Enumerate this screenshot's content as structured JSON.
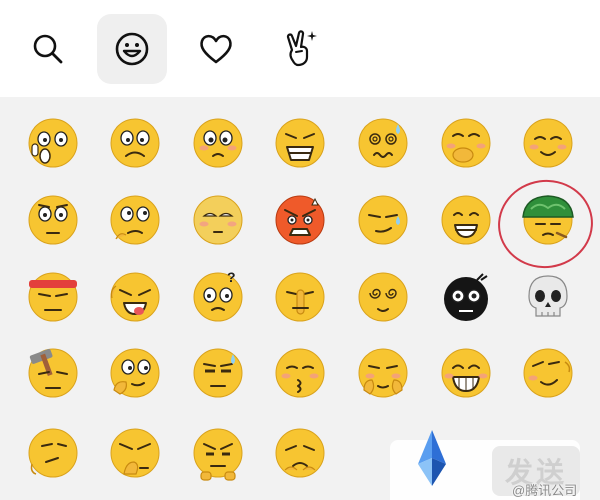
{
  "tabs": [
    {
      "name": "search",
      "icon": "search-icon",
      "active": false
    },
    {
      "name": "emoji",
      "icon": "smiley-icon",
      "active": true
    },
    {
      "name": "favorites",
      "icon": "heart-icon",
      "active": false
    },
    {
      "name": "gestures",
      "icon": "victory-hand-icon",
      "active": false
    }
  ],
  "emoji_grid": {
    "rows": 5,
    "columns": 7,
    "items": [
      "shocked-emoji",
      "frown-emoji",
      "crying-emoji",
      "sob-emoji",
      "dizzy-sweat-emoji",
      "cover-mouth-emoji",
      "blush-smile-emoji",
      "wide-eyes-emoji",
      "thinking-emoji",
      "rolling-eyes-emoji",
      "angry-emoji",
      "smirk-sweat-emoji",
      "grin-emoji",
      "green-hat-emoji",
      "headband-emoji",
      "tongue-out-emoji",
      "dizzy-emoji",
      "shush-emoji",
      "spiral-eyes-emoji",
      "black-face-emoji",
      "skull-emoji",
      "hammer-emoji",
      "chin-rub-emoji",
      "side-eye-sweat-emoji",
      "kissy-emoji",
      "cheeky-emoji",
      "big-grin-emoji",
      "tilted-smile-emoji",
      "hmph-emoji",
      "facepalm-emoji",
      "annoyed-emoji",
      "pitiful-emoji"
    ],
    "highlighted_item": "green-hat-emoji",
    "highlight_color": "#d23a4a"
  },
  "send_button": {
    "label": "发送"
  },
  "watermark": {
    "text": "@腾讯公司"
  },
  "colors": {
    "panel_bg": "#f2f2f2",
    "emoji_yellow": "#f7c531",
    "active_tab_bg": "#efefef"
  }
}
